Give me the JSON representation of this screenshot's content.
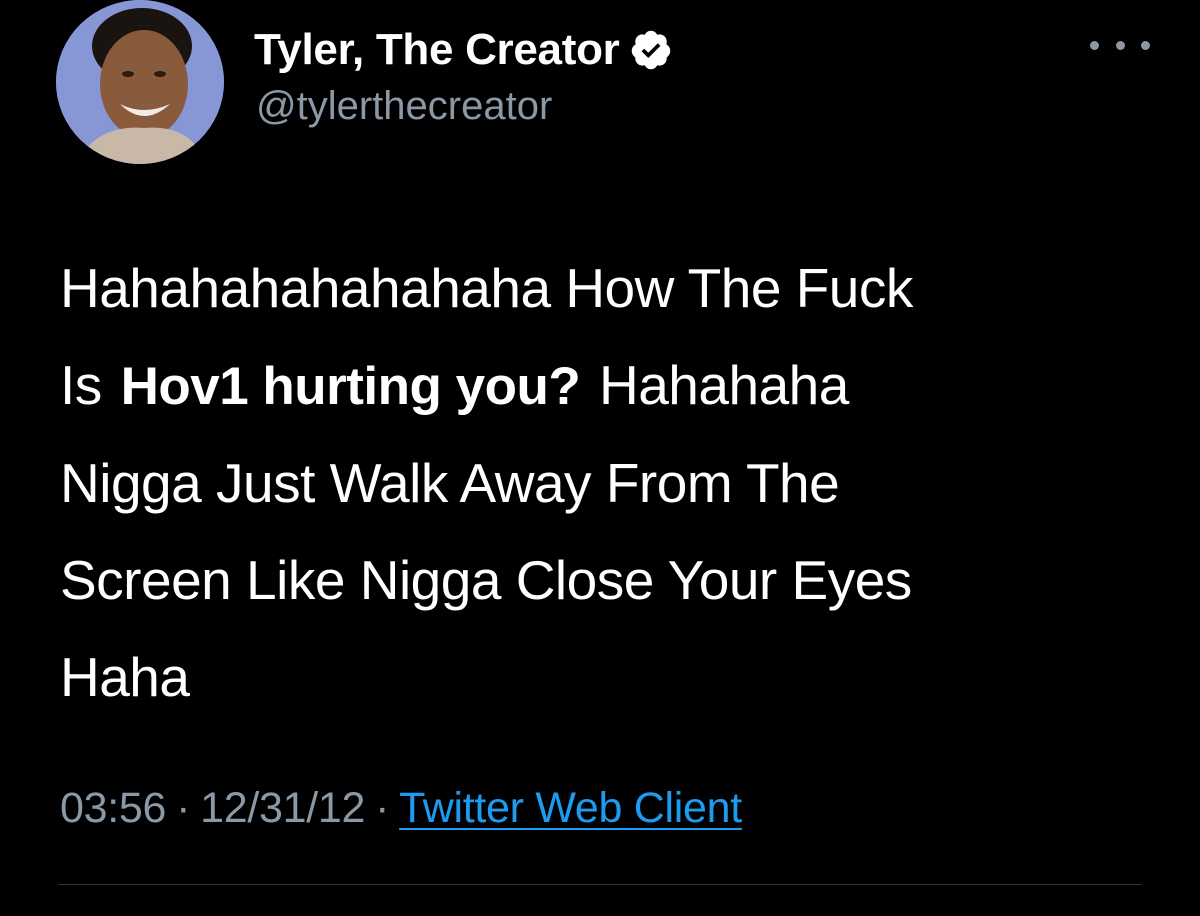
{
  "author": {
    "display_name": "Tyler, The Creator",
    "handle": "@tylerthecreator",
    "verified": true,
    "avatar_icon": "profile-avatar"
  },
  "tweet": {
    "lines": [
      "Hahahahahahahaha How The Fuck",
      "Is ",
      "Nigga Just Walk Away From The",
      "Screen Like Nigga Close Your Eyes",
      "Haha"
    ],
    "overlay_caption": "Hov1 hurting you?",
    "line2_tail": " Hahahaha"
  },
  "meta": {
    "time": "03:56",
    "date": "12/31/12",
    "separator": "·",
    "source": "Twitter Web Client"
  },
  "icons": {
    "verified": "verified-badge-icon",
    "more": "more-options-icon"
  },
  "colors": {
    "background": "#000000",
    "text": "#ffffff",
    "secondary": "#8b98a5",
    "link": "#1d9bf0"
  }
}
